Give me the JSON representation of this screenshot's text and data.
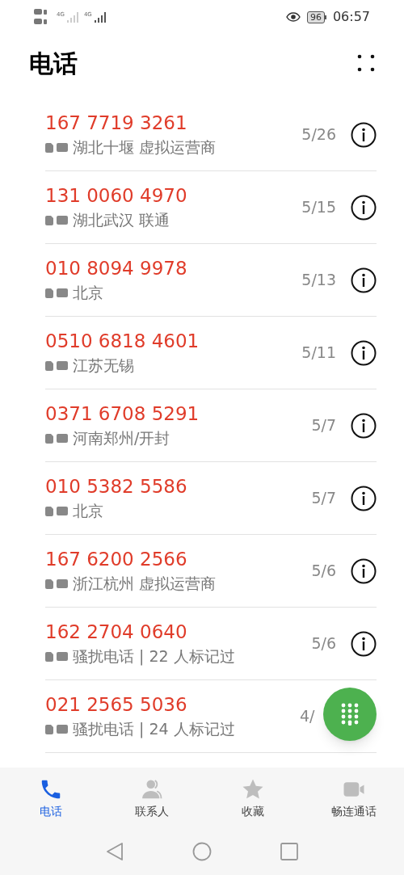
{
  "status_bar": {
    "network_labels": [
      "4G",
      "4G"
    ],
    "battery": "96",
    "time": "06:57"
  },
  "title": "电话",
  "calls": [
    {
      "number": "167 7719 3261",
      "location": "湖北十堰 虚拟运营商",
      "date": "5/26"
    },
    {
      "number": "131 0060 4970",
      "location": "湖北武汉 联通",
      "date": "5/15"
    },
    {
      "number": "010 8094 9978",
      "location": "北京",
      "date": "5/13"
    },
    {
      "number": "0510 6818 4601",
      "location": "江苏无锡",
      "date": "5/11"
    },
    {
      "number": "0371 6708 5291",
      "location": "河南郑州/开封",
      "date": "5/7"
    },
    {
      "number": "010 5382 5586",
      "location": "北京",
      "date": "5/7"
    },
    {
      "number": "167 6200 2566",
      "location": "浙江杭州 虚拟运营商",
      "date": "5/6"
    },
    {
      "number": "162 2704 0640",
      "location": "骚扰电话 | 22 人标记过",
      "date": "5/6"
    },
    {
      "number": "021 2565 5036",
      "location": "骚扰电话 | 24 人标记过",
      "date": "4/",
      "info_button": false
    }
  ],
  "tabs": [
    {
      "kind": "phone",
      "label": "电话",
      "selected": true
    },
    {
      "kind": "contacts",
      "label": "联系人",
      "selected": false
    },
    {
      "kind": "favorites",
      "label": "收藏",
      "selected": false
    },
    {
      "kind": "video",
      "label": "畅连通话",
      "selected": false
    }
  ]
}
